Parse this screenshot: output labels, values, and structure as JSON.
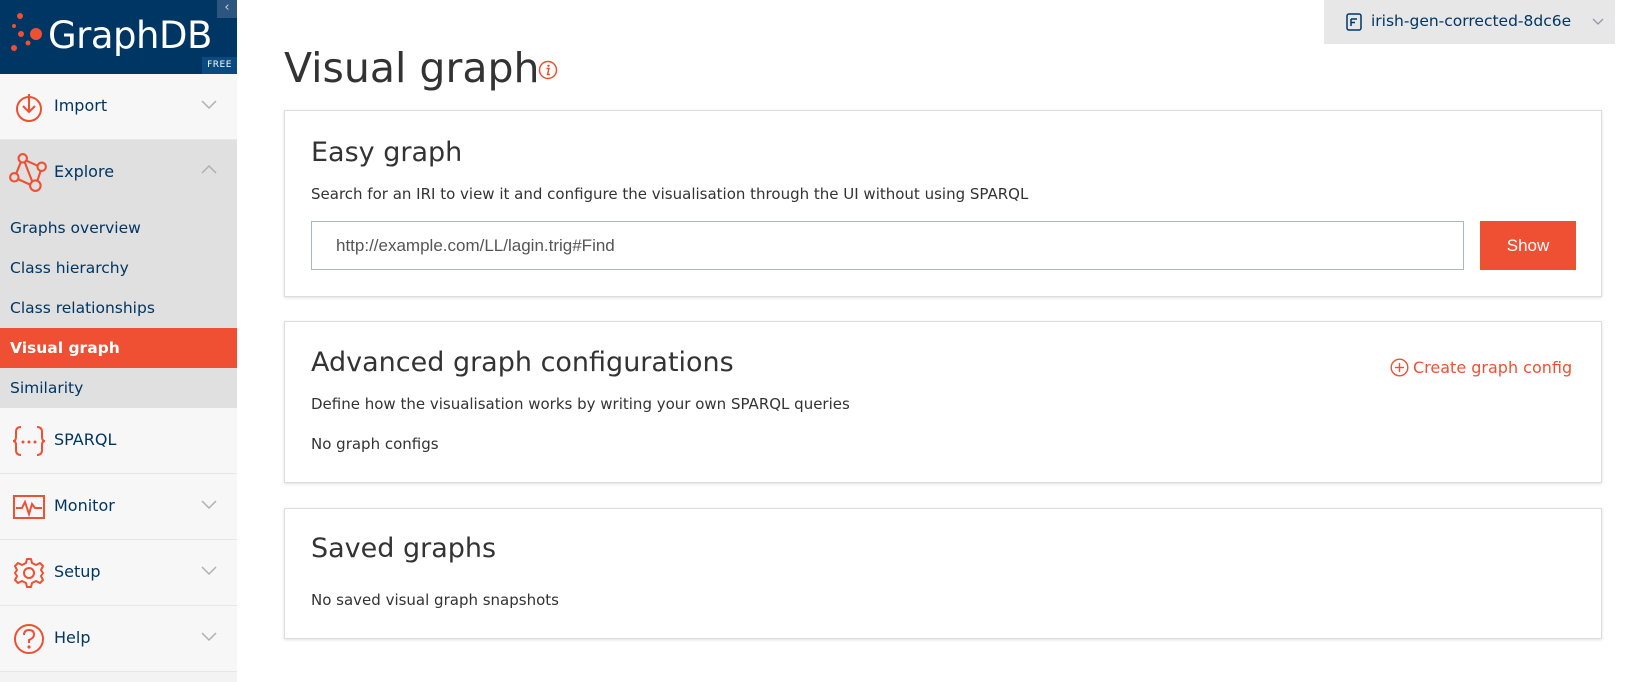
{
  "brand": {
    "name": "GraphDB",
    "edition": "FREE",
    "collapse_icon": "chevron-left-icon"
  },
  "sidebar": {
    "groups": [
      {
        "label": "Import",
        "icon": "import-icon",
        "expanded": false
      },
      {
        "label": "Explore",
        "icon": "explore-graph-icon",
        "expanded": true,
        "items": [
          {
            "label": "Graphs overview"
          },
          {
            "label": "Class hierarchy"
          },
          {
            "label": "Class relationships"
          },
          {
            "label": "Visual graph",
            "active": true
          },
          {
            "label": "Similarity"
          }
        ]
      },
      {
        "label": "SPARQL",
        "icon": "sparql-braces-icon"
      },
      {
        "label": "Monitor",
        "icon": "monitor-icon",
        "expanded": false
      },
      {
        "label": "Setup",
        "icon": "gear-icon",
        "expanded": false
      },
      {
        "label": "Help",
        "icon": "help-icon",
        "expanded": false
      }
    ]
  },
  "repository": {
    "name": "irish-gen-corrected-8dc6e"
  },
  "page": {
    "title": "Visual graph"
  },
  "easy_graph": {
    "title": "Easy graph",
    "description": "Search for an IRI to view it and configure the visualisation through the UI without using SPARQL",
    "input_value": "http://example.com/LL/lagin.trig#Find",
    "show_label": "Show"
  },
  "advanced": {
    "title": "Advanced graph configurations",
    "description": "Define how the visualisation works by writing your own SPARQL queries",
    "empty": "No graph configs",
    "create_label": "Create graph config"
  },
  "saved": {
    "title": "Saved graphs",
    "empty": "No saved visual graph snapshots"
  },
  "colors": {
    "accent": "#ef5033",
    "brand": "#003663",
    "sidebar_bg": "#f3f3f3",
    "submenu_bg": "#e0e0e0"
  }
}
